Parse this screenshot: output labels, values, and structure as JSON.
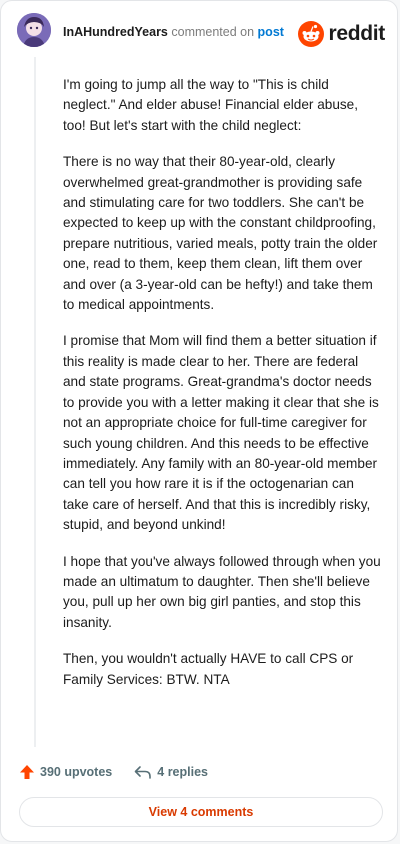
{
  "header": {
    "username": "InAHundredYears",
    "action_text": "commented on",
    "target_text": "post",
    "brand": "reddit"
  },
  "comment": {
    "paragraphs": [
      "I'm going to jump all the way to \"This is child neglect.\" And elder abuse! Financial elder abuse, too! But let's start with the child neglect:",
      "There is no way that their 80-year-old, clearly overwhelmed great-grandmother is providing safe and stimulating care for two toddlers. She can't be expected to keep up with the constant childproofing, prepare nutritious, varied meals, potty train the older one, read to them, keep them clean, lift them over and over (a 3-year-old can be hefty!) and take them to medical appointments.",
      "I promise that Mom will find them a better situation if this reality is made clear to her. There are federal and state programs. Great-grandma's doctor needs to provide you with a letter making it clear that she is not an appropriate choice for full-time caregiver for such young children. And this needs to be effective immediately. Any family with an 80-year-old member can tell you how rare it is if the octogenarian can take care of herself. And that this is incredibly risky, stupid, and beyond unkind!",
      "I hope that you've always followed through when you made an ultimatum to daughter. Then she'll believe you, pull up her own big girl panties, and stop this insanity.",
      "Then, you wouldn't actually HAVE to call CPS or Family Services: BTW. NTA"
    ]
  },
  "actions": {
    "upvotes": "390 upvotes",
    "replies": "4 replies",
    "view_comments": "View 4 comments"
  },
  "colors": {
    "accent_orange": "#ff4500",
    "link_blue": "#0079d3",
    "view_button_text": "#d93a00"
  },
  "icons": {
    "avatar": "avatar-image",
    "brand_logo": "reddit-snoo-icon",
    "upvote": "upvote-arrow-icon",
    "reply": "reply-arrow-icon"
  }
}
